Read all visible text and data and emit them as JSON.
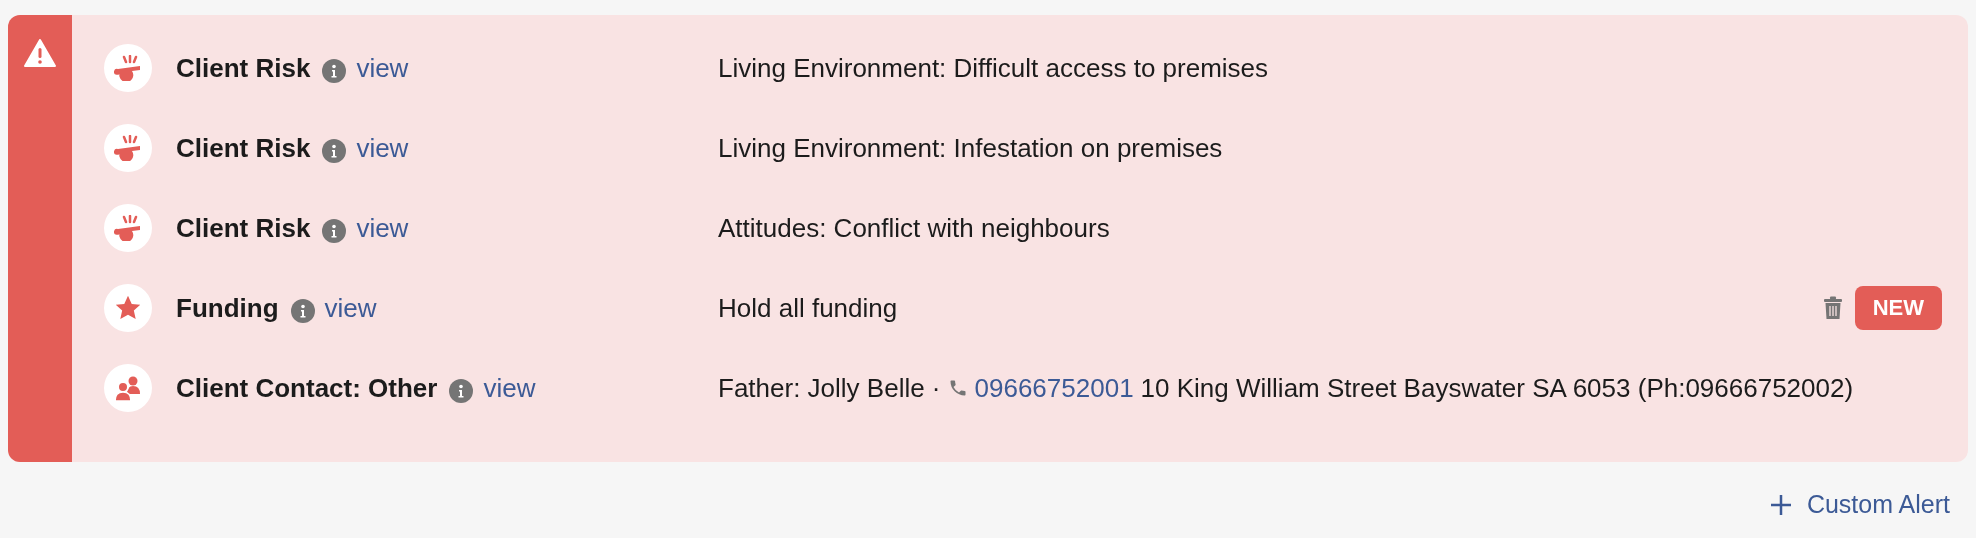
{
  "alerts": [
    {
      "kind": "risk",
      "title": "Client Risk",
      "link": "view",
      "detail": "Living Environment: Difficult access to premises",
      "deletable": false,
      "new": false
    },
    {
      "kind": "risk",
      "title": "Client Risk",
      "link": "view",
      "detail": "Living Environment: Infestation on premises",
      "deletable": false,
      "new": false
    },
    {
      "kind": "risk",
      "title": "Client Risk",
      "link": "view",
      "detail": "Attitudes: Conflict with neighbours",
      "deletable": false,
      "new": false
    },
    {
      "kind": "funding",
      "title": "Funding",
      "link": "view",
      "detail": "Hold all funding",
      "deletable": true,
      "new": true,
      "badge": "NEW"
    },
    {
      "kind": "contact",
      "title": "Client Contact: Other",
      "link": "view",
      "detail": "Father: Jolly Belle ·",
      "phone": "09666752001",
      "detail_after": "10 King William Street Bayswater SA 6053 (Ph:09666752002)",
      "deletable": false,
      "new": false
    }
  ],
  "add_button": {
    "label": "Custom Alert"
  }
}
